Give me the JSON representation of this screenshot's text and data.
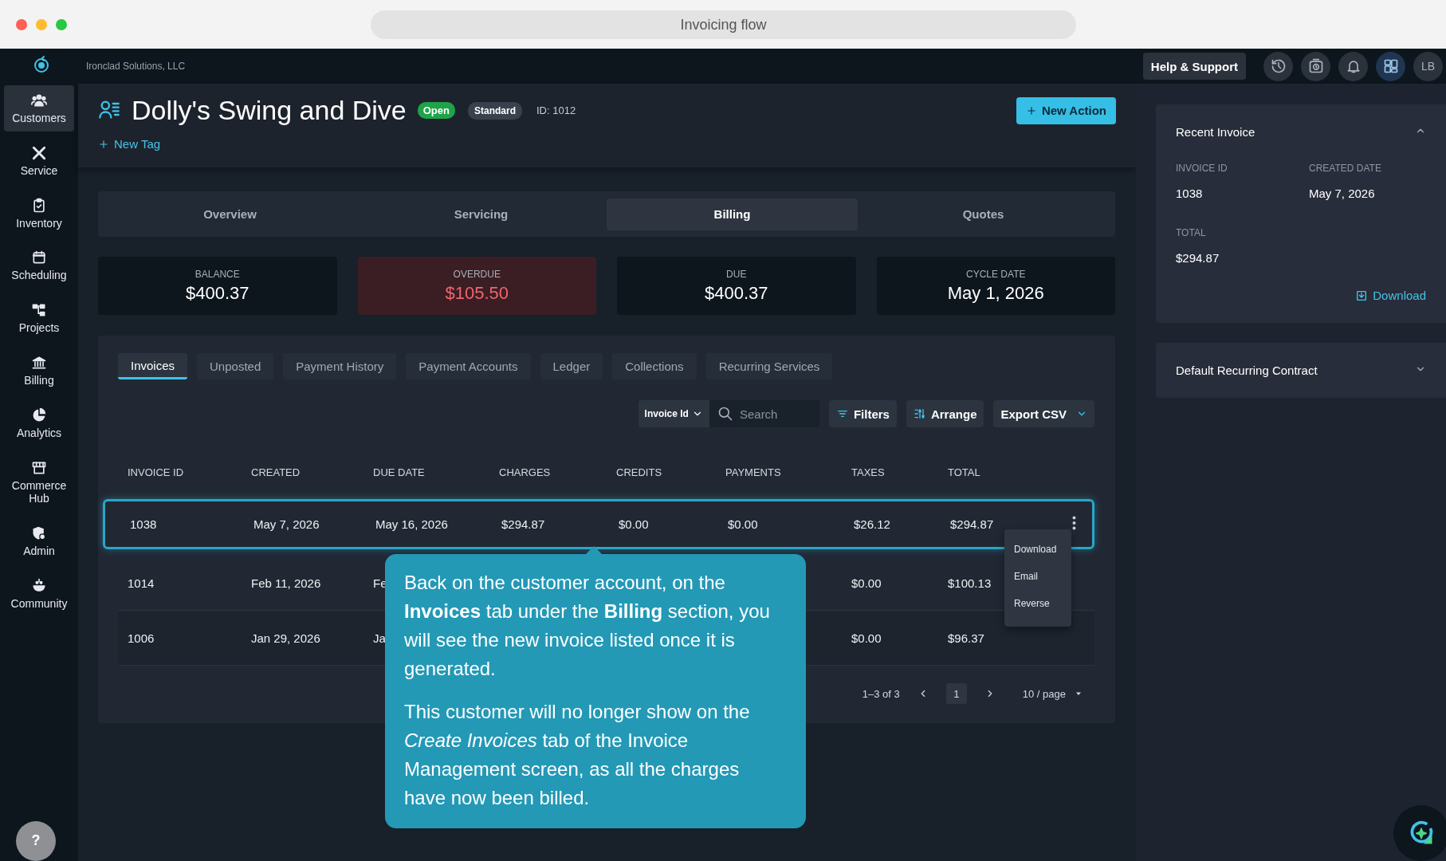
{
  "window": {
    "title": "Invoicing flow"
  },
  "topbar": {
    "company": "Ironclad Solutions, LLC",
    "help": "Help & Support",
    "avatar": "LB",
    "icons": [
      {
        "kind": "history",
        "selected": false
      },
      {
        "kind": "timer",
        "selected": false
      },
      {
        "kind": "bell",
        "selected": false
      },
      {
        "kind": "dashboard",
        "selected": true
      }
    ]
  },
  "sidebar": {
    "items": [
      {
        "label": "Customers",
        "kind": "people",
        "selected": true
      },
      {
        "label": "Service",
        "kind": "tools",
        "selected": false
      },
      {
        "label": "Inventory",
        "kind": "clipboard",
        "selected": false
      },
      {
        "label": "Scheduling",
        "kind": "calendar",
        "selected": false
      },
      {
        "label": "Projects",
        "kind": "tree",
        "selected": false
      },
      {
        "label": "Billing",
        "kind": "bank",
        "selected": false
      },
      {
        "label": "Analytics",
        "kind": "pie",
        "selected": false
      },
      {
        "label": "Commerce Hub",
        "kind": "store",
        "selected": false
      },
      {
        "label": "Admin",
        "kind": "shield",
        "selected": false
      },
      {
        "label": "Community",
        "kind": "community",
        "selected": false
      }
    ]
  },
  "customer": {
    "name": "Dolly's Swing and Dive",
    "status": "Open",
    "tier": "Standard",
    "id": "ID: 1012",
    "new_tag": "New Tag",
    "action": "New Action"
  },
  "tabs": [
    {
      "label": "Overview",
      "selected": false
    },
    {
      "label": "Servicing",
      "selected": false
    },
    {
      "label": "Billing",
      "selected": true
    },
    {
      "label": "Quotes",
      "selected": false
    }
  ],
  "stats": [
    {
      "label": "BALANCE",
      "value": "$400.37",
      "alert": false
    },
    {
      "label": "OVERDUE",
      "value": "$105.50",
      "alert": true
    },
    {
      "label": "DUE",
      "value": "$400.37",
      "alert": false
    },
    {
      "label": "CYCLE DATE",
      "value": "May 1, 2026",
      "alert": false
    }
  ],
  "billing": {
    "subtabs": [
      {
        "label": "Invoices",
        "selected": true
      },
      {
        "label": "Unposted",
        "selected": false
      },
      {
        "label": "Payment History",
        "selected": false
      },
      {
        "label": "Payment Accounts",
        "selected": false
      },
      {
        "label": "Ledger",
        "selected": false
      },
      {
        "label": "Collections",
        "selected": false
      },
      {
        "label": "Recurring Services",
        "selected": false
      }
    ],
    "toolbar": {
      "field": "Invoice Id",
      "search_placeholder": "Search",
      "filters": "Filters",
      "arrange": "Arrange",
      "export": "Export CSV"
    },
    "table": {
      "columns": [
        "INVOICE ID",
        "CREATED",
        "DUE DATE",
        "CHARGES",
        "CREDITS",
        "PAYMENTS",
        "TAXES",
        "TOTAL"
      ],
      "rows": [
        {
          "selected": true,
          "cells": [
            "1038",
            "May 7, 2026",
            "May 16, 2026",
            "$294.87",
            "$0.00",
            "$0.00",
            "$26.12",
            "$294.87"
          ]
        },
        {
          "selected": false,
          "cells": [
            "1014",
            "Feb 11, 2026",
            "Fe",
            null,
            null,
            null,
            "$0.00",
            "$100.13"
          ]
        },
        {
          "selected": false,
          "cells": [
            "1006",
            "Jan 29, 2026",
            "Ja",
            null,
            null,
            null,
            "$0.00",
            "$96.37"
          ]
        }
      ]
    },
    "row_menu": [
      "Download",
      "Email",
      "Reverse"
    ],
    "pagination": {
      "range": "1–3 of 3",
      "page": "1",
      "page_size": "10 / page"
    }
  },
  "recent_invoice": {
    "title": "Recent Invoice",
    "expanded": true,
    "fields": [
      {
        "label": "INVOICE ID",
        "value": "1038"
      },
      {
        "label": "CREATED DATE",
        "value": "May 7, 2026"
      },
      {
        "label": "TOTAL",
        "value": "$294.87"
      }
    ],
    "download": "Download"
  },
  "contract": {
    "title": "Default Recurring Contract",
    "expanded": false
  },
  "tooltip": {
    "paragraphs": [
      "Back on the customer account, on the **Invoices** tab under the **Billing** section, you will see the new invoice listed once it is generated.",
      "This customer will no longer show on the *Create Invoices* tab of the Invoice Management screen, as all the charges have now been billed."
    ]
  },
  "help_button": "?"
}
